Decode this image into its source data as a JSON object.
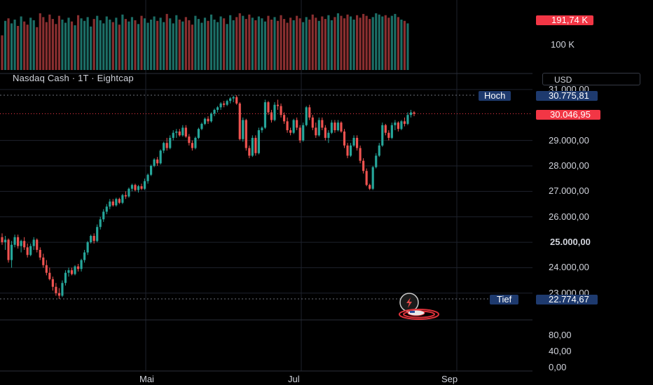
{
  "header": {
    "title": "Nasdaq Cash · 1T · Eightcap",
    "currency": "USD"
  },
  "volume_axis": {
    "current": "191,74 K",
    "tick": "100 K"
  },
  "price_axis": {
    "ticks": [
      "31.000,00",
      "29.000,00",
      "28.000,00",
      "27.000,00",
      "26.000,00",
      "25.000,00",
      "24.000,00",
      "23.000,00"
    ],
    "ticks_values": [
      31000,
      29000,
      28000,
      27000,
      26000,
      25000,
      24000,
      23000
    ],
    "high_label": "Hoch",
    "high_value": "30.775,81",
    "low_label": "Tief",
    "low_value": "22.774,67",
    "last_value": "30.046,95"
  },
  "indicator_axis": {
    "ticks": [
      "80,00",
      "40,00",
      "0,00"
    ]
  },
  "time_axis": {
    "labels": [
      "Mai",
      "Jul",
      "Sep"
    ]
  },
  "colors": {
    "up": "#26a69a",
    "down": "#ef5350",
    "high_tag": "#1e3a6e",
    "last_tag": "#f23645",
    "grid": "#1e222d"
  },
  "icons": [
    "flash-icon",
    "flag-us-icon"
  ],
  "chart_data": {
    "type": "candlestick",
    "ylim": [
      22200,
      31300
    ],
    "ohlc": [
      [
        25200,
        25350,
        24900,
        25000
      ],
      [
        25000,
        25250,
        24700,
        25100
      ],
      [
        25100,
        25150,
        24200,
        24300
      ],
      [
        24300,
        25050,
        24000,
        24900
      ],
      [
        24900,
        25300,
        24800,
        25200
      ],
      [
        25200,
        25300,
        24750,
        24850
      ],
      [
        24850,
        25100,
        24600,
        25050
      ],
      [
        25050,
        25200,
        24700,
        24800
      ],
      [
        24800,
        24950,
        24400,
        24500
      ],
      [
        24500,
        24950,
        24450,
        24850
      ],
      [
        24850,
        25200,
        24700,
        25100
      ],
      [
        25100,
        25150,
        24600,
        24700
      ],
      [
        24700,
        24800,
        24300,
        24400
      ],
      [
        24400,
        24550,
        24000,
        24100
      ],
      [
        24100,
        24300,
        23700,
        23800
      ],
      [
        23800,
        24000,
        23500,
        23550
      ],
      [
        23550,
        23650,
        23100,
        23250
      ],
      [
        23250,
        23400,
        22900,
        23000
      ],
      [
        23000,
        23200,
        22775,
        22900
      ],
      [
        22900,
        23500,
        22850,
        23400
      ],
      [
        23400,
        23900,
        23300,
        23800
      ],
      [
        23800,
        24000,
        23650,
        23900
      ],
      [
        23900,
        24000,
        23700,
        23750
      ],
      [
        23750,
        24100,
        23700,
        24050
      ],
      [
        24050,
        24150,
        23850,
        23950
      ],
      [
        23950,
        24350,
        23850,
        24300
      ],
      [
        24300,
        24700,
        24200,
        24600
      ],
      [
        24600,
        25050,
        24500,
        25000
      ],
      [
        25000,
        25300,
        24950,
        25250
      ],
      [
        25250,
        25350,
        24950,
        25050
      ],
      [
        25050,
        25700,
        25000,
        25600
      ],
      [
        25600,
        26000,
        25500,
        25900
      ],
      [
        25900,
        26300,
        25800,
        26200
      ],
      [
        26200,
        26500,
        26100,
        26400
      ],
      [
        26400,
        26700,
        26300,
        26600
      ],
      [
        26600,
        26700,
        26400,
        26450
      ],
      [
        26450,
        26750,
        26400,
        26700
      ],
      [
        26700,
        26750,
        26500,
        26550
      ],
      [
        26550,
        26900,
        26500,
        26850
      ],
      [
        26850,
        27000,
        26700,
        26800
      ],
      [
        26800,
        27150,
        26750,
        27100
      ],
      [
        27100,
        27300,
        27000,
        27250
      ],
      [
        27250,
        27300,
        27000,
        27050
      ],
      [
        27050,
        27250,
        26950,
        27200
      ],
      [
        27200,
        27300,
        27050,
        27100
      ],
      [
        27100,
        27500,
        27050,
        27400
      ],
      [
        27400,
        27700,
        27300,
        27650
      ],
      [
        27650,
        28050,
        27600,
        28000
      ],
      [
        28000,
        28300,
        27950,
        28250
      ],
      [
        28250,
        28350,
        28000,
        28100
      ],
      [
        28100,
        28650,
        28050,
        28600
      ],
      [
        28600,
        28950,
        28500,
        28900
      ],
      [
        28900,
        29100,
        28600,
        28700
      ],
      [
        28700,
        29200,
        28650,
        29100
      ],
      [
        29100,
        29400,
        29000,
        29300
      ],
      [
        29300,
        29450,
        29100,
        29350
      ],
      [
        29350,
        29450,
        29150,
        29200
      ],
      [
        29200,
        29600,
        29150,
        29500
      ],
      [
        29500,
        29600,
        29100,
        29150
      ],
      [
        29150,
        29250,
        28800,
        28900
      ],
      [
        28900,
        29000,
        28600,
        28700
      ],
      [
        28700,
        29150,
        28650,
        29100
      ],
      [
        29100,
        29500,
        29050,
        29450
      ],
      [
        29450,
        29700,
        29400,
        29650
      ],
      [
        29650,
        29900,
        29600,
        29850
      ],
      [
        29850,
        29950,
        29650,
        29750
      ],
      [
        29750,
        30100,
        29700,
        30050
      ],
      [
        30050,
        30250,
        29950,
        30200
      ],
      [
        30200,
        30350,
        30100,
        30300
      ],
      [
        30300,
        30500,
        30200,
        30450
      ],
      [
        30450,
        30550,
        30300,
        30400
      ],
      [
        30400,
        30600,
        30350,
        30550
      ],
      [
        30550,
        30700,
        30450,
        30650
      ],
      [
        30650,
        30760,
        30500,
        30700
      ],
      [
        30700,
        30776,
        30400,
        30450
      ],
      [
        30450,
        30500,
        29000,
        29050
      ],
      [
        29050,
        29900,
        28950,
        29800
      ],
      [
        29800,
        29850,
        28600,
        28700
      ],
      [
        28700,
        28800,
        28300,
        28400
      ],
      [
        28400,
        29200,
        28350,
        29100
      ],
      [
        29100,
        29200,
        28400,
        28500
      ],
      [
        28500,
        29500,
        28450,
        29400
      ],
      [
        29400,
        29550,
        29300,
        29500
      ],
      [
        29500,
        30600,
        29450,
        30500
      ],
      [
        30500,
        30550,
        30000,
        30100
      ],
      [
        30100,
        30200,
        29700,
        29800
      ],
      [
        29800,
        30500,
        29750,
        30400
      ],
      [
        30400,
        30600,
        30200,
        30350
      ],
      [
        30350,
        30450,
        29900,
        30000
      ],
      [
        30000,
        30100,
        29650,
        29750
      ],
      [
        29750,
        29900,
        29300,
        29400
      ],
      [
        29400,
        29500,
        29200,
        29300
      ],
      [
        29300,
        29850,
        29250,
        29800
      ],
      [
        29800,
        29900,
        29400,
        29500
      ],
      [
        29500,
        29600,
        28900,
        29000
      ],
      [
        29000,
        29700,
        28950,
        29600
      ],
      [
        29600,
        30350,
        29550,
        30300
      ],
      [
        30300,
        30400,
        29800,
        29900
      ],
      [
        29900,
        30000,
        29400,
        29500
      ],
      [
        29500,
        29700,
        29100,
        29200
      ],
      [
        29200,
        29900,
        29150,
        29800
      ],
      [
        29800,
        29900,
        29400,
        29500
      ],
      [
        29500,
        29600,
        29000,
        29100
      ],
      [
        29100,
        29400,
        28900,
        29300
      ],
      [
        29300,
        29800,
        29250,
        29700
      ],
      [
        29700,
        29800,
        29300,
        29400
      ],
      [
        29400,
        29800,
        29350,
        29700
      ],
      [
        29700,
        29750,
        29300,
        29350
      ],
      [
        29350,
        29450,
        28700,
        28800
      ],
      [
        28800,
        28900,
        28300,
        28400
      ],
      [
        28400,
        28900,
        28350,
        28800
      ],
      [
        28800,
        29200,
        28750,
        29100
      ],
      [
        29100,
        29200,
        28600,
        28700
      ],
      [
        28700,
        28800,
        28100,
        28200
      ],
      [
        28200,
        28300,
        27700,
        27800
      ],
      [
        27800,
        27900,
        27200,
        27250
      ],
      [
        27250,
        27300,
        27050,
        27100
      ],
      [
        27100,
        28000,
        27050,
        27950
      ],
      [
        27950,
        28500,
        27900,
        28400
      ],
      [
        28400,
        28900,
        28350,
        28800
      ],
      [
        28800,
        29700,
        28750,
        29600
      ],
      [
        29600,
        29650,
        29200,
        29300
      ],
      [
        29300,
        29400,
        29000,
        29100
      ],
      [
        29100,
        29700,
        29050,
        29600
      ],
      [
        29600,
        29800,
        29400,
        29700
      ],
      [
        29700,
        29750,
        29350,
        29450
      ],
      [
        29450,
        29800,
        29400,
        29750
      ],
      [
        29750,
        29900,
        29550,
        29650
      ],
      [
        29650,
        30100,
        29600,
        30000
      ],
      [
        30000,
        30200,
        29900,
        30100
      ],
      [
        30100,
        30150,
        29950,
        30047
      ]
    ],
    "volume": [
      0.55,
      0.78,
      0.82,
      0.74,
      0.8,
      0.7,
      0.85,
      0.77,
      0.72,
      0.83,
      0.79,
      0.68,
      0.9,
      0.84,
      0.76,
      0.88,
      0.81,
      0.73,
      0.86,
      0.8,
      0.75,
      0.83,
      0.77,
      0.71,
      0.87,
      0.82,
      0.78,
      0.84,
      0.69,
      0.81,
      0.86,
      0.79,
      0.74,
      0.85,
      0.8,
      0.76,
      0.83,
      0.72,
      0.88,
      0.81,
      0.77,
      0.84,
      0.79,
      0.73,
      0.86,
      0.82,
      0.75,
      0.8,
      0.85,
      0.78,
      0.83,
      0.76,
      0.89,
      0.82,
      0.74,
      0.87,
      0.8,
      0.77,
      0.84,
      0.79,
      0.72,
      0.86,
      0.81,
      0.75,
      0.83,
      0.78,
      0.88,
      0.8,
      0.76,
      0.85,
      0.82,
      0.73,
      0.87,
      0.79,
      0.84,
      0.9,
      0.86,
      0.81,
      0.88,
      0.83,
      0.79,
      0.85,
      0.82,
      0.77,
      0.86,
      0.8,
      0.84,
      0.78,
      0.87,
      0.81,
      0.75,
      0.83,
      0.79,
      0.86,
      0.82,
      0.76,
      0.84,
      0.8,
      0.88,
      0.83,
      0.78,
      0.85,
      0.81,
      0.87,
      0.79,
      0.84,
      0.9,
      0.86,
      0.82,
      0.88,
      0.85,
      0.8,
      0.87,
      0.83,
      0.89,
      0.86,
      0.81,
      0.84,
      0.9,
      0.88,
      0.85,
      0.87,
      0.83,
      0.86,
      0.89,
      0.84,
      0.8,
      0.78,
      0.74
    ]
  }
}
